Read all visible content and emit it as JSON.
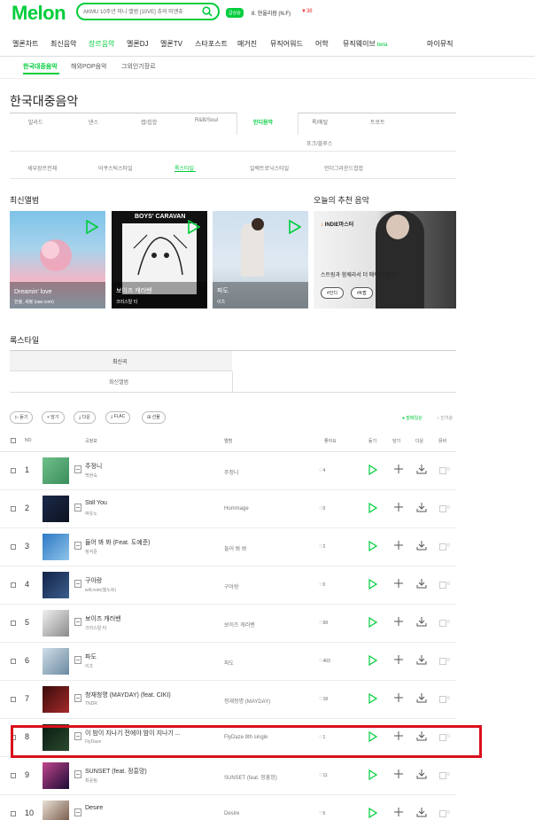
{
  "header": {
    "logo": "Melon",
    "search_value": "AKMU 10주년 미니 앨범 [10VE] 츄의 미앤츄",
    "live_badge": "급상승",
    "rank_text": "8. 현울리잠 (N.F)",
    "rank_change": "▼38"
  },
  "gnb": {
    "items": [
      "멜론차트",
      "최신음악",
      "장르음악",
      "멜론DJ",
      "멜론TV",
      "스타포스트",
      "매거진",
      "뮤직어워드",
      "어학",
      "뮤직웨이브"
    ],
    "beta": "beta",
    "my": "마이뮤직"
  },
  "subnav": {
    "items": [
      "한국대중음악",
      "해외POP음악",
      "그외인기장르"
    ]
  },
  "page_title": "한국대중음악",
  "genres": {
    "row1": [
      "발라드",
      "댄스",
      "랩/힙합",
      "R&B/Soul",
      "인디음악",
      "록/메탈",
      "트로트"
    ],
    "row2": [
      "포크/블루스"
    ]
  },
  "styles": [
    "세부장르전체",
    "어쿠스틱스타일",
    "록스타일",
    "일렉트로닉스타일",
    "언더그라운드힙합"
  ],
  "sections": {
    "latest_album": "최신앨범",
    "recommend": "오늘의 추천 음악",
    "rock_style": "록스타일"
  },
  "albums": [
    {
      "title": "Dreamin' love",
      "artist": "한율, 세봉 (sae.com)"
    },
    {
      "title": "보이즈 캐러밴",
      "artist": "크리스탈 티"
    },
    {
      "title": "파도",
      "artist": "이츠"
    }
  ],
  "album2_cover_text": "BOYS' CARAVAN",
  "recommend": {
    "label_prefix": "♪ ",
    "label": "INDIE마스터",
    "desc": "스트링과 함께라서 더 매력적 인디?",
    "btn1": "#인디",
    "btn2": "#K팝"
  },
  "tabs": [
    "최신곡",
    "최신앨범"
  ],
  "tools": [
    "▷ 듣기",
    "+ 담기",
    "⤓ 다운",
    "⤓ FLAC",
    "⊞ 선물"
  ],
  "sort": [
    "● 발매일순",
    "○ 인기순"
  ],
  "table_head": {
    "no": "NO",
    "song": "곡정보",
    "album": "앨범",
    "like": "좋아요",
    "listen": "듣기",
    "add": "담기",
    "down": "다운",
    "mv": "뮤비"
  },
  "rows": [
    {
      "rank": "1",
      "song": "주정니",
      "artist": "백현숙",
      "album": "주정니",
      "likes": "4"
    },
    {
      "rank": "2",
      "song": "Still You",
      "artist": "박유노",
      "album": "Hommage",
      "likes": "0"
    },
    {
      "rank": "3",
      "song": "들어 봐 봐 (Feat. 도예준)",
      "artist": "정석준",
      "album": "들어 봐 봐",
      "likes": "2"
    },
    {
      "rank": "4",
      "song": "구아랑",
      "artist": "will.note(윌노트)",
      "album": "구아랑",
      "likes": "0"
    },
    {
      "rank": "5",
      "song": "보이즈 캐러밴",
      "artist": "크리스탈 티",
      "album": "보이즈 캐러밴",
      "likes": "68"
    },
    {
      "rank": "6",
      "song": "파도",
      "artist": "이츠",
      "album": "파도",
      "likes": "403"
    },
    {
      "rank": "7",
      "song": "청재청명 (MAYDAY) (feat. CIKI)",
      "artist": "TNDR",
      "album": "청재청명 (MAYDAY)",
      "likes": "18"
    },
    {
      "rank": "8",
      "song": "이 밤이 지나기 전에야 밤이 지나기 ...",
      "artist": "FlyDaze",
      "album": "FlyDaze 9th single",
      "likes": "1"
    },
    {
      "rank": "9",
      "song": "SUNSET (feat. 정흥망)",
      "artist": "최윤림",
      "album": "SUNSET (feat. 정흥망)",
      "likes": "11"
    },
    {
      "rank": "10",
      "song": "Desire",
      "artist": "",
      "album": "Desire",
      "likes": "5"
    }
  ],
  "mv_count": "0",
  "colors": {
    "brand": "#00cd3c",
    "highlight": "#d9101c"
  }
}
